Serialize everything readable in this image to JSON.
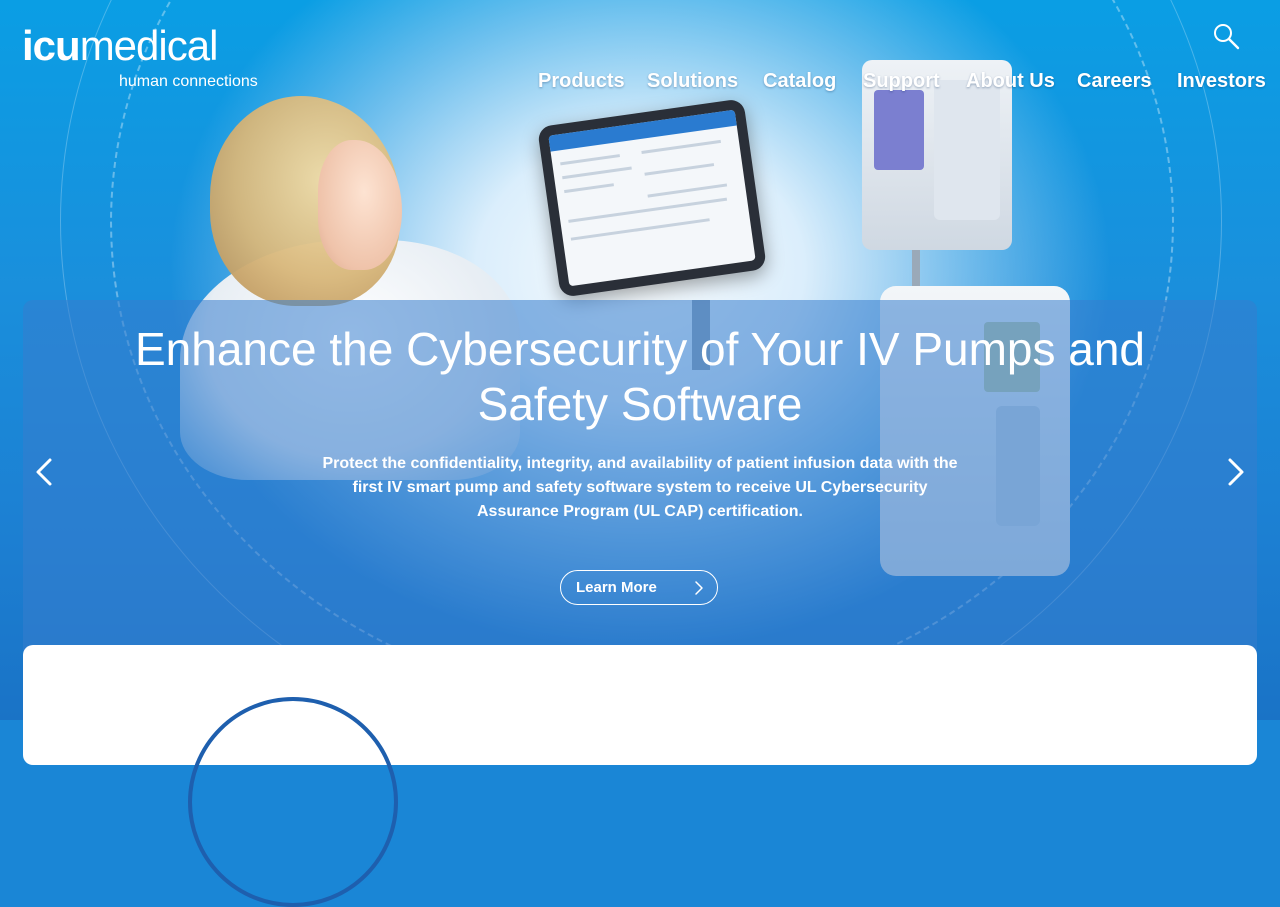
{
  "header": {
    "logo_bold": "icu",
    "logo_light": "medical",
    "tagline": "human connections",
    "search_icon": "search-icon"
  },
  "nav": {
    "items": [
      {
        "label": "Products"
      },
      {
        "label": "Solutions"
      },
      {
        "label": "Catalog"
      },
      {
        "label": "Support"
      },
      {
        "label": "About Us"
      },
      {
        "label": "Careers"
      },
      {
        "label": "Investors"
      }
    ]
  },
  "hero": {
    "title": "Enhance the Cybersecurity of Your IV Pumps and Safety Software",
    "description": "Protect the confidentiality, integrity, and availability of patient infusion data with the first IV smart pump and safety software system to receive UL Cybersecurity Assurance Program (UL CAP) certification.",
    "cta_label": "Learn More",
    "prev_icon": "chevron-left-icon",
    "next_icon": "chevron-right-icon",
    "cta_icon": "chevron-right-icon"
  },
  "colors": {
    "accent_blue": "#1a86d6",
    "panel_blue": "#377dcd",
    "card_circle": "#1e5fae"
  }
}
